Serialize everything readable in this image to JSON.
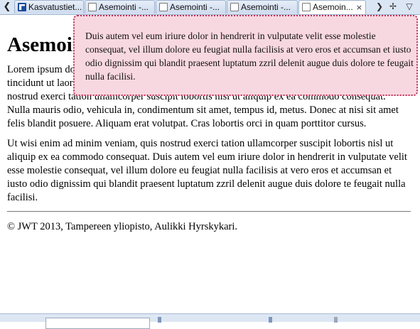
{
  "tabs": [
    {
      "label": "Kasvatustiet...",
      "active": false,
      "icon": "vm-logo-icon"
    },
    {
      "label": "Asemointi -...",
      "active": false,
      "icon": "page-icon"
    },
    {
      "label": "Asemointi -...",
      "active": false,
      "icon": "page-icon"
    },
    {
      "label": "Asemointi -...",
      "active": false,
      "icon": "page-icon"
    },
    {
      "label": "Asemoin...",
      "active": true,
      "icon": "page-icon",
      "close": "×"
    }
  ],
  "toolbar": {
    "back_glyph": "❮",
    "forward_glyph": "❯",
    "new_tab_glyph": "✢",
    "menu_glyph": "▽"
  },
  "page": {
    "heading": "Asemointi",
    "paragraph1": "Lorem ipsum dolor sit amet, consectetuer adipiscing elit, sed diam nonummy nibh euismod tincidunt ut laoreet dolore magna aliquam erat volutpat. Ut wisi enim ad minim veniam, quis nostrud exerci tation ullamcorper suscipit lobortis nisl ut aliquip ex ea commodo consequat. Nulla mauris odio, vehicula in, condimentum sit amet, tempus id, metus. Donec at nisi sit amet felis blandit posuere. Aliquam erat volutpat. Cras lobortis orci in quam porttitor cursus.",
    "paragraph2": "Ut wisi enim ad minim veniam, quis nostrud exerci tation ullamcorper suscipit lobortis nisl ut aliquip ex ea commodo consequat. Duis autem vel eum iriure dolor in hendrerit in vulputate velit esse molestie consequat, vel illum dolore eu feugiat nulla facilisis at vero eros et accumsan et iusto odio dignissim qui blandit praesent luptatum zzril delenit augue duis dolore te feugait nulla facilisi.",
    "footer": "© JWT 2013, Tampereen yliopisto, Aulikki Hyrskykari."
  },
  "popup": {
    "text": "Duis autem vel eum iriure dolor in hendrerit in vulputate velit esse molestie consequat, vel illum dolore eu feugiat nulla facilisis at vero eros et accumsan et iusto odio dignissim qui blandit praesent luptatum zzril delenit augue duis dolore te feugait nulla facilisi."
  },
  "colors": {
    "popup_bg": "#f8d8e0",
    "popup_border": "#c0335a",
    "tabbar_bg": "#dbe6f4"
  }
}
